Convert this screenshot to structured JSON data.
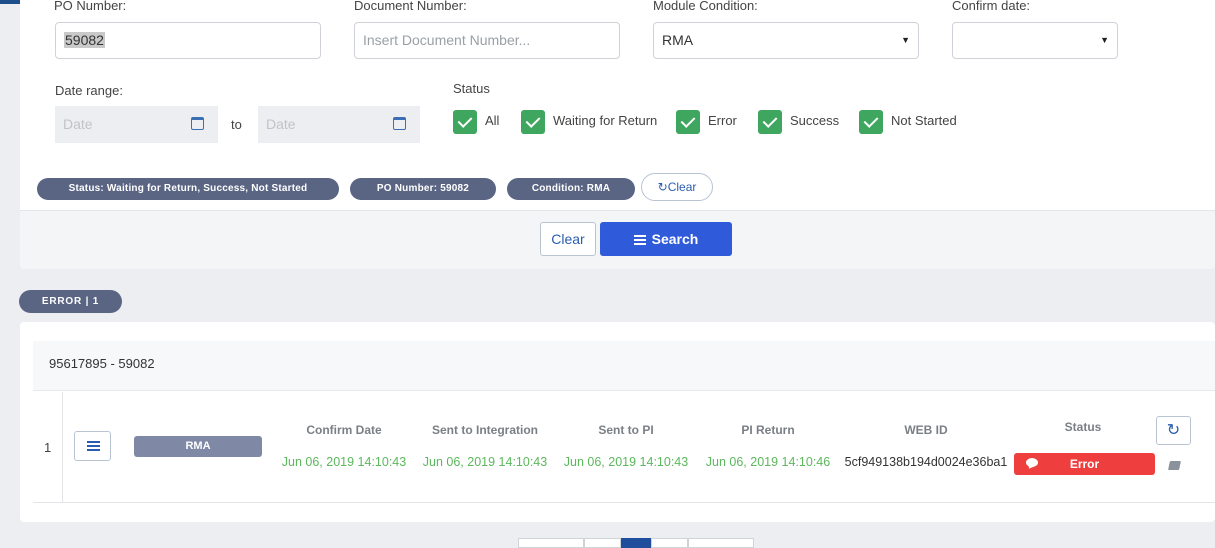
{
  "filters": {
    "po_number": {
      "label": "PO Number:",
      "value": "59082"
    },
    "document_number": {
      "label": "Document Number:",
      "placeholder": "Insert Document Number..."
    },
    "module_condition": {
      "label": "Module Condition:",
      "value": "RMA"
    },
    "confirm_date": {
      "label": "Confirm date:",
      "value": ""
    },
    "date_range": {
      "label": "Date range:",
      "from_placeholder": "Date",
      "to_label": "to",
      "to_placeholder": "Date"
    },
    "status": {
      "label": "Status",
      "options": [
        {
          "label": "All",
          "checked": true
        },
        {
          "label": "Waiting for Return",
          "checked": true
        },
        {
          "label": "Error",
          "checked": true
        },
        {
          "label": "Success",
          "checked": true
        },
        {
          "label": "Not Started",
          "checked": true
        }
      ]
    }
  },
  "active_filters": [
    "Status: Waiting for Return, Success, Not Started",
    "PO Number: 59082",
    "Condition: RMA"
  ],
  "chip_clear_label": "Clear",
  "actions": {
    "clear_label": "Clear",
    "search_label": "Search"
  },
  "group_pill": "ERROR | 1",
  "result": {
    "header": "95617895 - 59082",
    "rows": [
      {
        "index": "1",
        "type": "RMA",
        "columns": [
          {
            "header": "Confirm Date",
            "value": "Jun 06, 2019 14:10:43"
          },
          {
            "header": "Sent to Integration",
            "value": "Jun 06, 2019 14:10:43"
          },
          {
            "header": "Sent to PI",
            "value": "Jun 06, 2019 14:10:43"
          },
          {
            "header": "PI Return",
            "value": "Jun 06, 2019 14:10:46"
          },
          {
            "header": "WEB ID",
            "value": "5cf949138b194d0024e36ba1"
          }
        ],
        "status_header": "Status",
        "status": "Error"
      }
    ]
  },
  "colors": {
    "primary": "#2f5bdb",
    "success_check": "#3fa65f",
    "pill": "#5a6584",
    "error": "#ee3e3e",
    "date_green": "#5cb85c"
  },
  "icons": [
    "calendar-icon",
    "check-icon",
    "refresh-icon",
    "sliders-icon",
    "list-icon",
    "comment-icon",
    "book-icon"
  ]
}
